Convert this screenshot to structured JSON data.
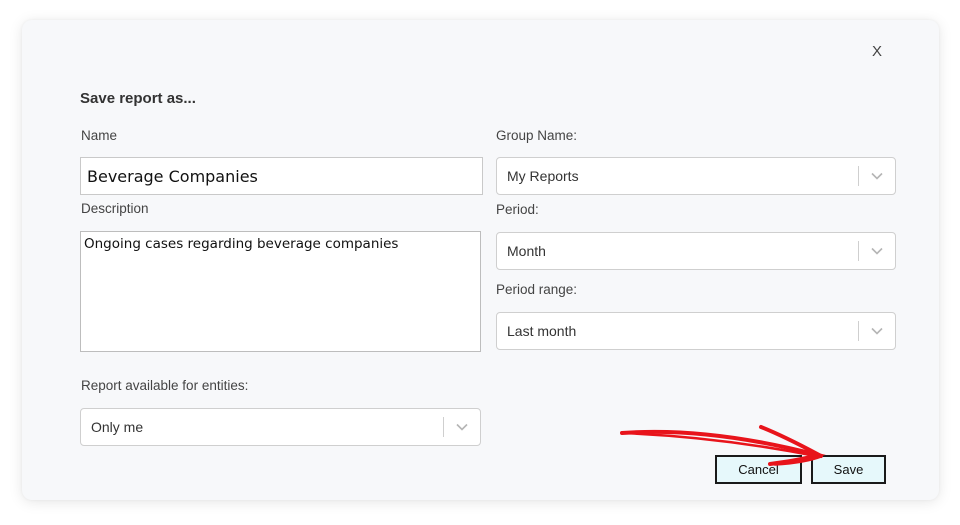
{
  "dialog": {
    "title": "Save report as...",
    "close_label": "X"
  },
  "form": {
    "name_label": "Name",
    "name_value": "Beverage Companies",
    "description_label": "Description",
    "description_value": "Ongoing cases regarding beverage companies",
    "group_label": "Group Name:",
    "group_value": "My Reports",
    "period_label": "Period:",
    "period_value": "Month",
    "period_range_label": "Period range:",
    "period_range_value": "Last month",
    "entities_label": "Report available for entities:",
    "entities_value": "Only me"
  },
  "buttons": {
    "cancel_label": "Cancel",
    "save_label": "Save"
  },
  "colors": {
    "annotation_arrow": "#e8141b",
    "button_background": "#e6f8fb",
    "dialog_background": "#f7f8fa"
  },
  "icons": {
    "select_chevron": "chevron-down-icon",
    "close": "close-icon",
    "annotation": "red-arrow-annotation"
  }
}
